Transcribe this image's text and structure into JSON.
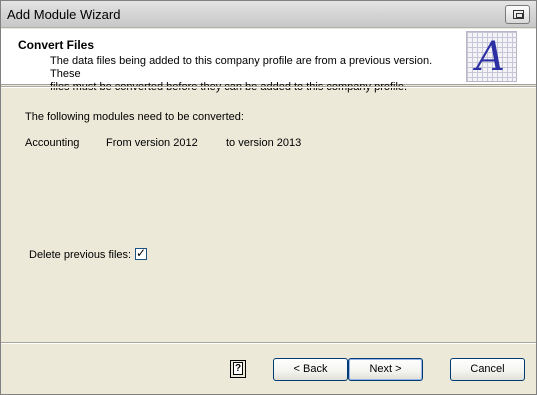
{
  "window": {
    "title": "Add Module Wizard"
  },
  "header": {
    "heading": "Convert Files",
    "description_line1": "The data files being added to this company profile are from a previous version. These",
    "description_line2": "files must be converted before they can be added to this company profile.",
    "logo_letter": "A"
  },
  "body": {
    "intro": "The following modules need to be converted:",
    "modules": [
      {
        "name": "Accounting",
        "from": "From version 2012",
        "to": "to version 2013"
      }
    ],
    "delete_label": "Delete previous files:",
    "delete_checked": true,
    "check_glyph": "✓"
  },
  "footer": {
    "help_glyph": "?",
    "back_label": "< Back",
    "next_label": "Next >",
    "cancel_label": "Cancel"
  },
  "colors": {
    "accent": "#2b2fa3",
    "button_border": "#003c74",
    "face": "#ece9d8"
  },
  "icons": {
    "system_menu": "restore-icon",
    "help": "help-icon",
    "logo": "app-logo-icon"
  }
}
